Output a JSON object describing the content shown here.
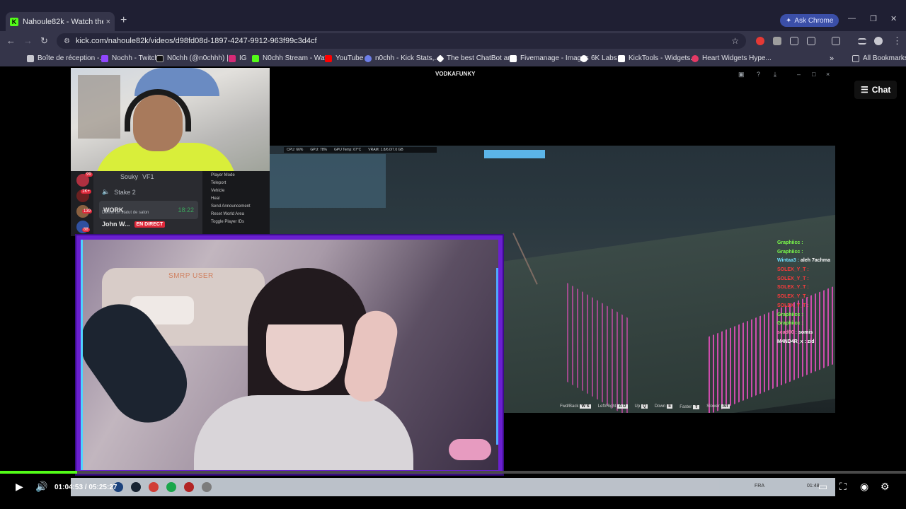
{
  "browser": {
    "tab_title": "Nahoule82k - Watch the VOD o",
    "tab_close": "×",
    "new_tab": "+",
    "ask_chrome": "Ask Chrome",
    "url": "kick.com/nahoule82k/videos/d98fd08d-1897-4247-9912-963f99c3d4cf",
    "bookmarks": [
      "Boîte de réception -...",
      "Nochh - Twitch",
      "N0chh (@n0chhh) |...",
      "IG",
      "N0chh Stream - Wat...",
      "YouTube",
      "n0chh - Kick Stats,...",
      "The best ChatBot an...",
      "Fivemanage - Images",
      "6K Labs",
      "KickTools - Widgets...",
      "Heart Widgets Hype..."
    ],
    "all_bookmarks": "All Bookmarks"
  },
  "discord": {
    "rows": [
      "Souky",
      "VF1",
      "Stake 2",
      "WORK",
      "Définir un statut de salon",
      "John W...",
      "EN DIRECT"
    ],
    "work_time": "18:22",
    "menu": [
      "Player Mode",
      "Teleport",
      "Vehicle",
      "Heal",
      "Send Announcement",
      "Reset World Area",
      "Toggle Player IDs"
    ],
    "badges": [
      "99",
      "1K+",
      "139",
      "88"
    ]
  },
  "game": {
    "window_title": "VODKAFUNKY",
    "hud": [
      "CPU: 66%",
      "GPU: 78%",
      "GPU Temp: 67°C",
      "VRAM: 1.8/6.0/7.0 GB"
    ],
    "keys": [
      {
        "label": "Fwd/Back",
        "keys": "W S"
      },
      {
        "label": "Left/Right",
        "keys": "A D"
      },
      {
        "label": "Up",
        "keys": "Q"
      },
      {
        "label": "Down",
        "keys": "E"
      },
      {
        "label": "Faster",
        "keys": "⇧"
      },
      {
        "label": "Slower",
        "keys": "Alt"
      }
    ],
    "chat": [
      {
        "user": "Graphiicc :",
        "msg": "",
        "color": "#7cff4a"
      },
      {
        "user": "Graphiicc :",
        "msg": "",
        "color": "#7cff4a"
      },
      {
        "user": "Wintaa3 :",
        "msg": "aleh 7achma",
        "color": "#6ee0ff"
      },
      {
        "user": "SOLEX_Y_T :",
        "msg": "",
        "color": "#ff3b3b"
      },
      {
        "user": "SOLEX_Y_T :",
        "msg": "",
        "color": "#ff3b3b"
      },
      {
        "user": "SOLEX_Y_T :",
        "msg": "",
        "color": "#ff3b3b"
      },
      {
        "user": "SOLEX_Y_T :",
        "msg": "",
        "color": "#ff3b3b"
      },
      {
        "user": "SOLEX_Y_T :",
        "msg": "",
        "color": "#ff3b3b"
      },
      {
        "user": "Graphiicc :",
        "msg": "",
        "color": "#7cff4a"
      },
      {
        "user": "Graphiicc :",
        "msg": "",
        "color": "#7cff4a"
      },
      {
        "user": "scad00 :",
        "msg": "somis",
        "color": "#ff7eb6"
      },
      {
        "user": "M4ND4R_x :",
        "msg": "zid",
        "color": "#ffffff"
      }
    ]
  },
  "facecam": {
    "neon_text": "SMRP USER"
  },
  "chat_button": "Chat",
  "player": {
    "time": "01:04:53 / 05:25:27",
    "progress": 0.0855,
    "tray_lang": "FRA",
    "tray_time": "01:48"
  }
}
